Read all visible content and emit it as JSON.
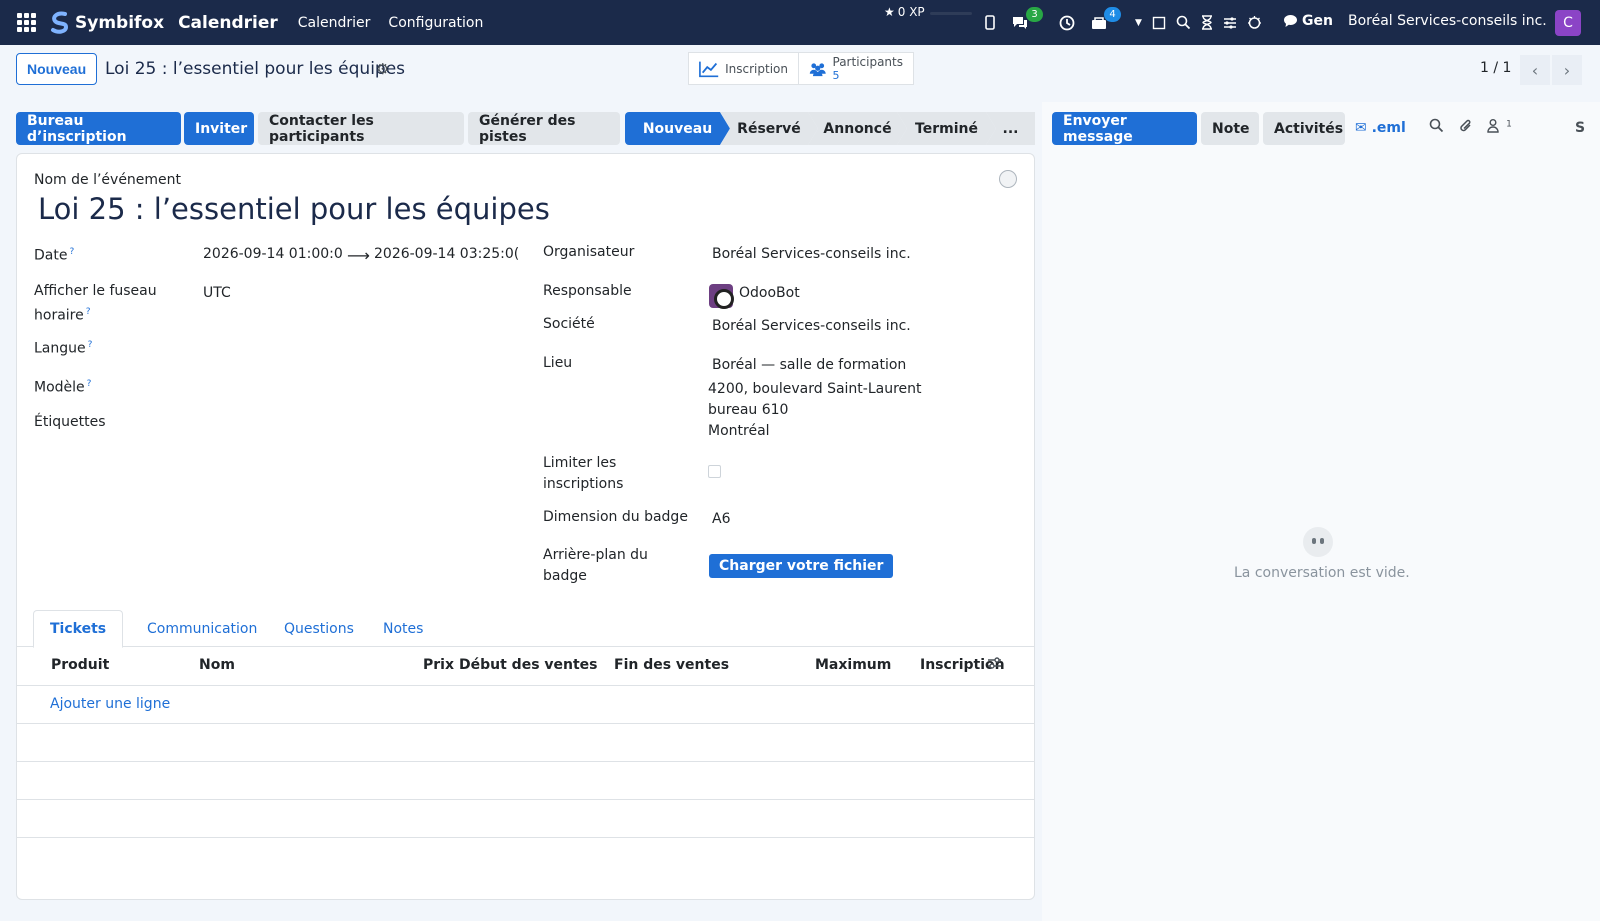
{
  "navbar": {
    "brand": "Symbifox",
    "app": "Calendrier",
    "menus": [
      "Calendrier",
      "Configuration"
    ],
    "xp": "0 XP",
    "chat_badge": "3",
    "activity_badge": "4",
    "gen": "Gen",
    "company": "Boréal Services-conseils inc.",
    "avatar_letter": "C"
  },
  "control": {
    "new_button": "Nouveau",
    "record_title": "Loi 25 : l’essentiel pour les équipes",
    "smart_inscription": "Inscription",
    "smart_participants": "Participants",
    "smart_participants_count": "5",
    "pager": "1 / 1"
  },
  "statusbar": {
    "buttons": [
      "Bureau d’inscription",
      "Inviter",
      "Contacter les participants",
      "Générer des pistes"
    ],
    "stages": [
      "Nouveau",
      "Réservé",
      "Annoncé",
      "Terminé",
      "..."
    ]
  },
  "chatter": {
    "send": "Envoyer message",
    "note": "Note",
    "activities": "Activités",
    "eml": ".eml",
    "followers_count": "1",
    "letter": "S",
    "empty": "La conversation est vide."
  },
  "form": {
    "event_label": "Nom de l’événement",
    "event_name": "Loi 25 : l’essentiel pour les équipes",
    "left": {
      "date_label": "Date",
      "date_start": "2026-09-14 01:00:0",
      "date_end": "2026-09-14 03:25:0(",
      "tz_label_1": "Afficher le fuseau",
      "tz_label_2": "horaire",
      "tz_value": "UTC",
      "lang_label": "Langue",
      "model_label": "Modèle",
      "tags_label": "Étiquettes"
    },
    "right": {
      "organizer_label": "Organisateur",
      "organizer": "Boréal Services-conseils inc.",
      "responsible_label": "Responsable",
      "responsible": "OdooBot",
      "company_label": "Société",
      "company": "Boréal Services-conseils inc.",
      "venue_label": "Lieu",
      "venue_1": "Boréal — salle de formation",
      "venue_2": "4200, boulevard Saint-Laurent",
      "venue_3": "bureau 610",
      "venue_4": "Montréal",
      "limit_label_1": "Limiter les",
      "limit_label_2": "inscriptions",
      "badge_dim_label": "Dimension du badge",
      "badge_dim": "A6",
      "badge_bg_label_1": "Arrière-plan du",
      "badge_bg_label_2": "badge",
      "upload": "Charger votre fichier"
    }
  },
  "tabs": [
    "Tickets",
    "Communication",
    "Questions",
    "Notes"
  ],
  "table": {
    "headers": [
      "Produit",
      "Nom",
      "Prix",
      "Début des ventes",
      "Fin des ventes",
      "Maximum",
      "Inscription"
    ],
    "add_line": "Ajouter une ligne"
  },
  "colors": {
    "navbar": "#1b2a4a",
    "primary": "#1f6fd6",
    "avatar": "#8b44c6"
  }
}
